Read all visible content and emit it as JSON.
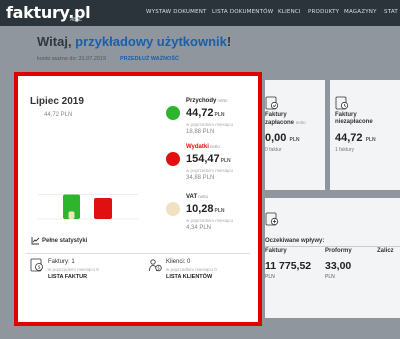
{
  "topbar": {
    "logo": "faktury.pl",
    "logo_sub": "ABSE",
    "nav": [
      "WYSTAW DOKUMENT",
      "LISTA DOKUMENTÓW",
      "KLIENCI",
      "PRODUKTY",
      "MAGAZYNY",
      "STAT"
    ]
  },
  "greeting": {
    "prefix": "Witaj, ",
    "user": "przykładowy użytkownik",
    "suffix": "!",
    "konto": "konto ważne do: 31.07.2019",
    "przedluz": "PRZEDŁUŻ WAŻNOŚĆ"
  },
  "summary": {
    "month": "Lipiec 2019",
    "y_top_label": "44,72 PLN",
    "pelne": "Pełne statystyki",
    "legend": [
      {
        "label": "Przychody",
        "netto": "netto",
        "value": "44,72",
        "currency": "PLN",
        "prev_label": "w poprzednim miesiącu",
        "prev_value": "18,88 PLN",
        "color": "#2db52d",
        "label_color": "#222222"
      },
      {
        "label": "Wydatki",
        "netto": "netto",
        "value": "154,47",
        "currency": "PLN",
        "prev_label": "w poprzednim miesiącu",
        "prev_value": "34,88 PLN",
        "color": "#e01010",
        "label_color": "#e01010"
      },
      {
        "label": "VAT",
        "netto": "netto",
        "value": "10,28",
        "currency": "PLN",
        "prev_label": "w poprzednim miesiącu",
        "prev_value": "4,34 PLN",
        "color": "#f0e2c0",
        "label_color": "#222222"
      }
    ],
    "faktury": {
      "title": "Faktury: 1",
      "prev": "w poprzednim miesiącu 8",
      "link": "LISTA FAKTUR"
    },
    "klienci": {
      "title": "Klienci: 0",
      "prev": "w poprzednim miesiącu 0",
      "link": "LISTA KLIENTÓW"
    }
  },
  "chart_data": {
    "type": "bar",
    "series": [
      {
        "name": "Przychody",
        "values": [
          44.72
        ],
        "color": "#2db52d"
      },
      {
        "name": "VAT",
        "values": [
          10.28
        ],
        "color": "#f0e2c0"
      },
      {
        "name": "Wydatki",
        "values": [
          154.47
        ],
        "color": "#e01010"
      }
    ],
    "categories": [
      "Lipiec 2019"
    ],
    "ylabel": "",
    "xlabel": "",
    "title": "Lipiec 2019"
  },
  "cards": {
    "zaplacone": {
      "title_l1": "Faktury",
      "title_l2": "zapłacone",
      "netto": "netto",
      "value": "0,00",
      "currency": "PLN",
      "sub": "0 faktur"
    },
    "niezaplacone": {
      "title_l1": "Faktury",
      "title_l2": "niezapłacone",
      "value": "44,72",
      "currency": "PLN",
      "sub": "1 faktury"
    }
  },
  "oczekiwane": {
    "title": "Oczekiwane wpływy:",
    "cols": [
      {
        "h": "Faktury",
        "v": "11 775,52",
        "u": "PLN"
      },
      {
        "h": "Proformy",
        "v": "33,00",
        "u": "PLN"
      },
      {
        "h": "Zalicz",
        "v": "",
        "u": ""
      }
    ]
  }
}
